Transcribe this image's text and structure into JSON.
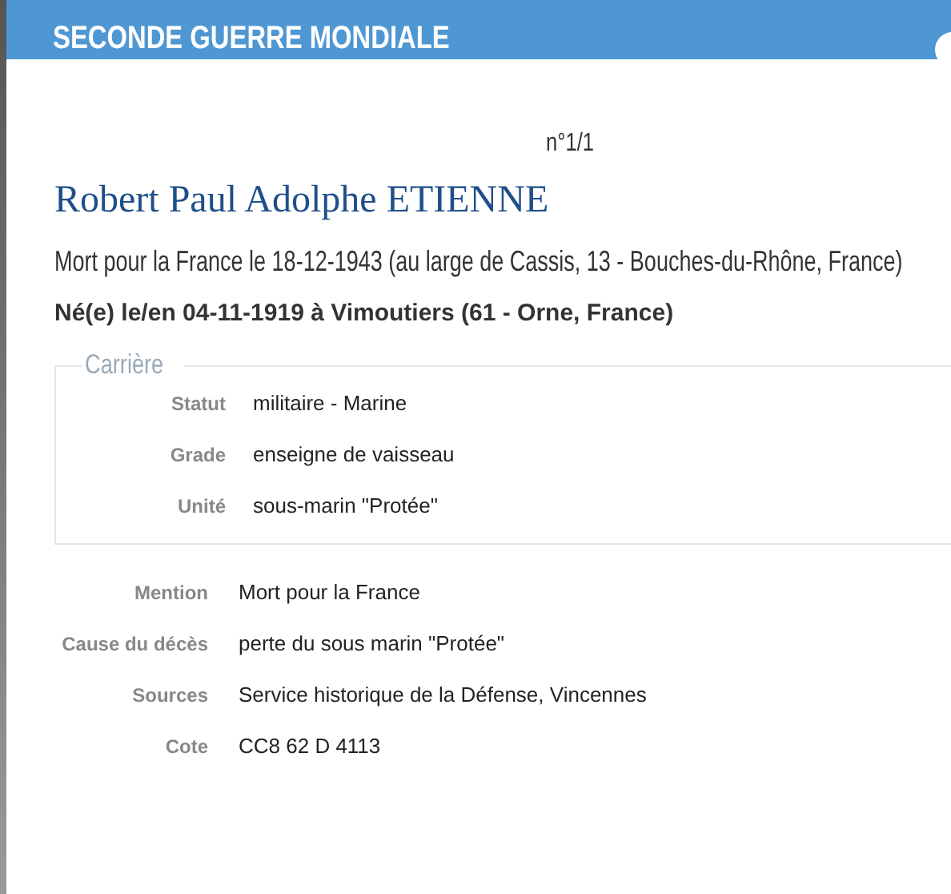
{
  "header": {
    "title": "SECONDE GUERRE MONDIALE"
  },
  "record_number": "n°1/1",
  "person": {
    "name": "Robert Paul Adolphe ETIENNE",
    "death": "Mort pour la France le 18-12-1943 (au large de Cassis, 13 - Bouches-du-Rhône, France)",
    "birth": "Né(e) le/en 04-11-1919 à Vimoutiers (61 - Orne, France)"
  },
  "career": {
    "legend": "Carrière",
    "fields": [
      {
        "label": "Statut",
        "value": "militaire - Marine"
      },
      {
        "label": "Grade",
        "value": "enseigne de vaisseau"
      },
      {
        "label": "Unité",
        "value": "sous-marin \"Protée\""
      }
    ]
  },
  "details": [
    {
      "label": "Mention",
      "value": "Mort pour la France"
    },
    {
      "label": "Cause du décès",
      "value": "perte du sous marin \"Protée\""
    },
    {
      "label": "Sources",
      "value": "Service historique de la Défense, Vincennes"
    },
    {
      "label": "Cote",
      "value": "CC8 62 D 4113"
    }
  ]
}
